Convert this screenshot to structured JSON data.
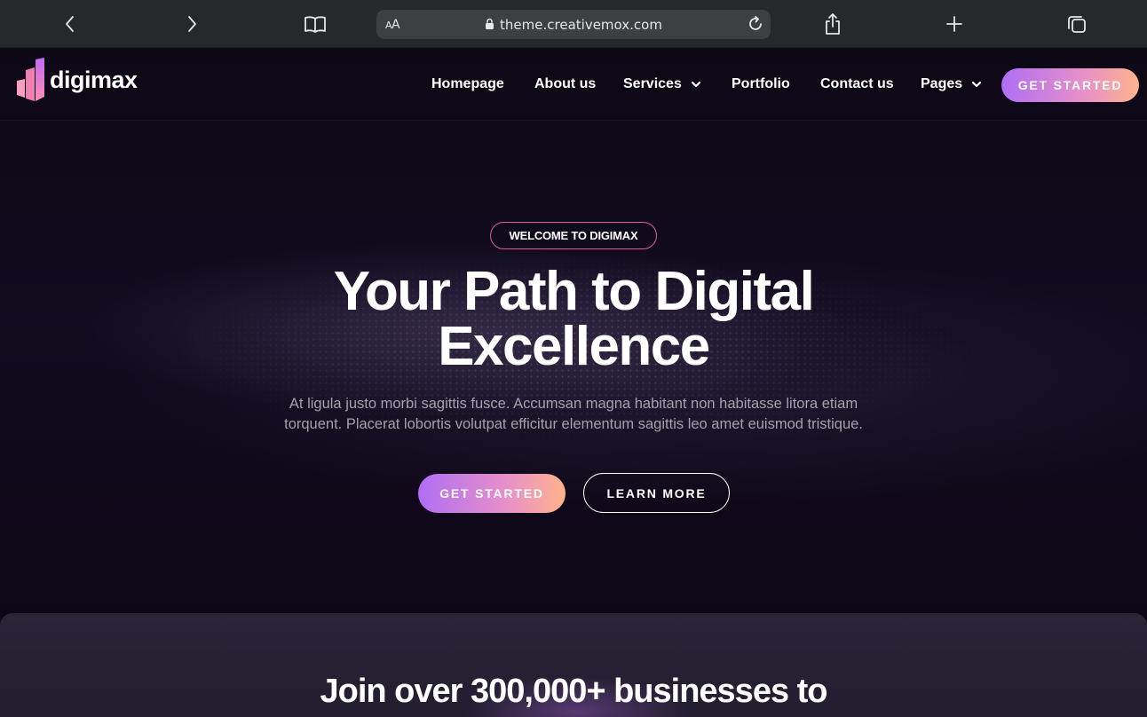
{
  "browser": {
    "text_size_label": "AA",
    "url": "theme.creativemox.com"
  },
  "logo": {
    "text": "digimax"
  },
  "nav": {
    "items": [
      {
        "label": "Homepage"
      },
      {
        "label": "About us"
      },
      {
        "label": "Services"
      },
      {
        "label": "Portfolio"
      },
      {
        "label": "Contact us"
      },
      {
        "label": "Pages"
      }
    ],
    "cta_label": "GET STARTED"
  },
  "hero": {
    "badge": "WELCOME TO DIGIMAX",
    "title_line1": "Your Path to Digital",
    "title_line2": "Excellence",
    "subtitle": "At ligula justo morbi sagittis fusce. Accumsan magna habitant non habitasse litora etiam torquent. Placerat lobortis volutpat efficitur elementum sagittis leo amet euismod tristique.",
    "primary_cta": "GET STARTED",
    "secondary_cta": "LEARN MORE"
  },
  "section": {
    "title": "Join over 300,000+ businesses to"
  },
  "colors": {
    "accent_gradient_start": "#b06ef5",
    "accent_gradient_end": "#ffb38a",
    "badge_border": "#e05aa0",
    "background": "#0d0816"
  }
}
